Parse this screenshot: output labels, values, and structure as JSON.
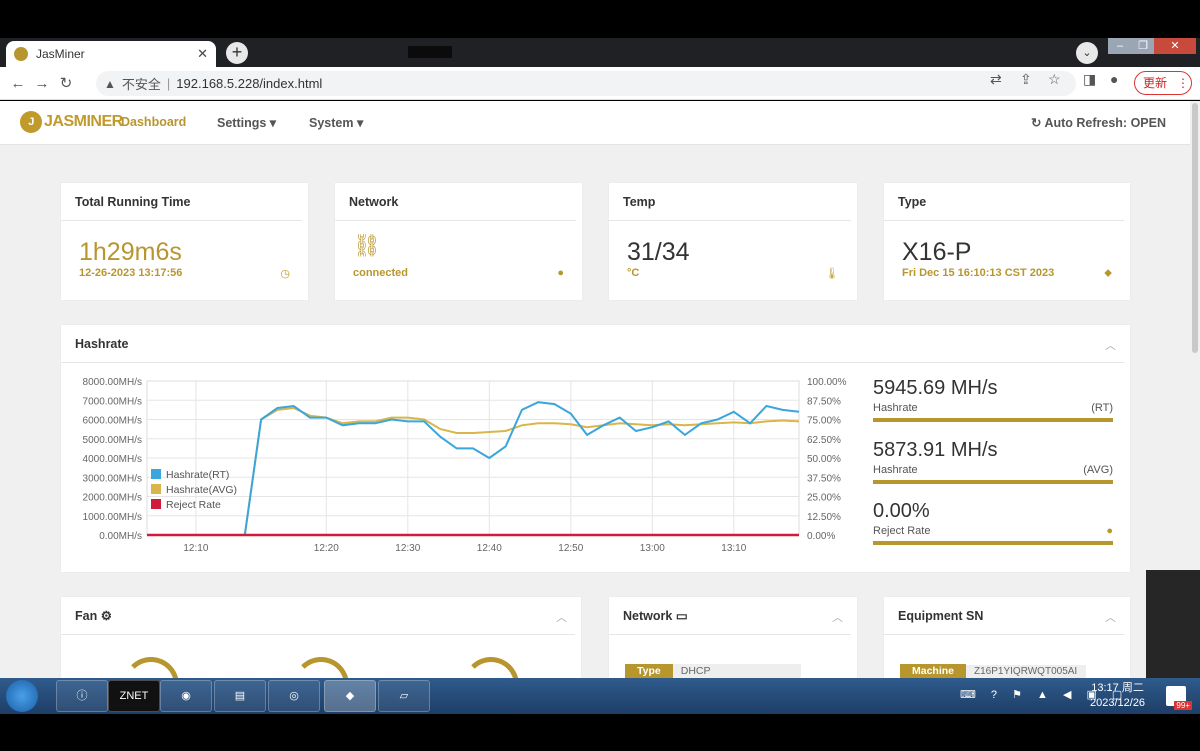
{
  "browser": {
    "tab_title": "JasMiner",
    "tab_close": "✕",
    "new_tab": "+",
    "security_label": "不安全",
    "url": "192.168.5.228/index.html",
    "update_label": "更新"
  },
  "navbar": {
    "logo": "JASMINER",
    "items": [
      "Dashboard",
      "Settings ▾",
      "System ▾"
    ],
    "auto_refresh": "Auto Refresh: OPEN"
  },
  "cards": {
    "running": {
      "title": "Total Running Time",
      "value": "1h29m6s",
      "sub": "12-26-2023 13:17:56",
      "icon": "clock-icon"
    },
    "network": {
      "title": "Network",
      "value": "connected",
      "icon": "link-icon"
    },
    "temp": {
      "title": "Temp",
      "value": "31/34",
      "sub": "°C",
      "icon": "thermometer-icon"
    },
    "type": {
      "title": "Type",
      "value": "X16-P",
      "sub": "Fri Dec 15 16:10:13 CST 2023",
      "icon": "tag-icon"
    }
  },
  "hashrate": {
    "title": "Hashrate",
    "rt_value": "5945.69 MH/s",
    "rt_label": "Hashrate",
    "rt_tag": "(RT)",
    "avg_value": "5873.91 MH/s",
    "avg_label": "Hashrate",
    "avg_tag": "(AVG)",
    "reject_value": "0.00%",
    "reject_label": "Reject Rate"
  },
  "bottom": {
    "fan_title": "Fan",
    "network_title": "Network",
    "network_type_key": "Type",
    "network_type_val": "DHCP",
    "sn_title": "Equipment SN",
    "sn_key": "Machine",
    "sn_val": "Z16P1YIQRWQT005AI"
  },
  "taskbar": {
    "time": "13:17 周二",
    "date": "2023/12/26",
    "badge": "99+"
  },
  "colors": {
    "accent": "#b8962e",
    "rt_series": "#3aa6dc",
    "avg_series": "#d9b54a",
    "reject_series": "#d11b3c"
  },
  "chart_data": {
    "type": "line",
    "x": [
      "12:04",
      "12:06",
      "12:08",
      "12:10",
      "12:12",
      "12:14",
      "12:15",
      "12:16",
      "12:17",
      "12:18",
      "12:19",
      "12:20",
      "12:22",
      "12:24",
      "12:26",
      "12:28",
      "12:30",
      "12:32",
      "12:34",
      "12:36",
      "12:38",
      "12:40",
      "12:42",
      "12:44",
      "12:46",
      "12:48",
      "12:50",
      "12:52",
      "12:54",
      "12:56",
      "12:58",
      "13:00",
      "13:02",
      "13:04",
      "13:06",
      "13:08",
      "13:10",
      "13:12",
      "13:14",
      "13:16",
      "13:18"
    ],
    "x_ticks": [
      "12:10",
      "12:20",
      "12:30",
      "12:40",
      "12:50",
      "13:00",
      "13:10"
    ],
    "series": [
      {
        "name": "Hashrate(RT)",
        "axis": "left",
        "values": [
          0,
          0,
          0,
          0,
          0,
          0,
          0,
          6000,
          6600,
          6700,
          6100,
          6100,
          5700,
          5800,
          5800,
          6000,
          5900,
          5900,
          5100,
          4500,
          4500,
          4000,
          4600,
          6500,
          6900,
          6800,
          6300,
          5200,
          5700,
          6100,
          5400,
          5600,
          5900,
          5200,
          5800,
          6000,
          6400,
          5800,
          6700,
          6500,
          6400
        ]
      },
      {
        "name": "Hashrate(AVG)",
        "axis": "left",
        "values": [
          0,
          0,
          0,
          0,
          0,
          0,
          0,
          6000,
          6500,
          6600,
          6200,
          6100,
          5800,
          5900,
          5900,
          6100,
          6100,
          6000,
          5500,
          5300,
          5300,
          5350,
          5400,
          5700,
          5800,
          5800,
          5750,
          5600,
          5700,
          5800,
          5750,
          5700,
          5750,
          5700,
          5750,
          5800,
          5850,
          5800,
          5900,
          5950,
          5900
        ]
      },
      {
        "name": "Reject Rate",
        "axis": "right",
        "values": [
          0,
          0,
          0,
          0,
          0,
          0,
          0,
          0,
          0,
          0,
          0,
          0,
          0,
          0,
          0,
          0,
          0,
          0,
          0,
          0,
          0,
          0,
          0,
          0,
          0,
          0,
          0,
          0,
          0,
          0,
          0,
          0,
          0,
          0,
          0,
          0,
          0,
          0,
          0,
          0,
          0
        ]
      }
    ],
    "y_left_ticks": [
      "0.00MH/s",
      "1000.00MH/s",
      "2000.00MH/s",
      "3000.00MH/s",
      "4000.00MH/s",
      "5000.00MH/s",
      "6000.00MH/s",
      "7000.00MH/s",
      "8000.00MH/s"
    ],
    "y_right_ticks": [
      "0.00%",
      "12.50%",
      "25.00%",
      "37.50%",
      "50.00%",
      "62.50%",
      "75.00%",
      "87.50%",
      "100.00%"
    ],
    "ylim_left": [
      0,
      8000
    ],
    "ylim_right": [
      0,
      100
    ],
    "legend": "bottom-left",
    "grid": true
  }
}
